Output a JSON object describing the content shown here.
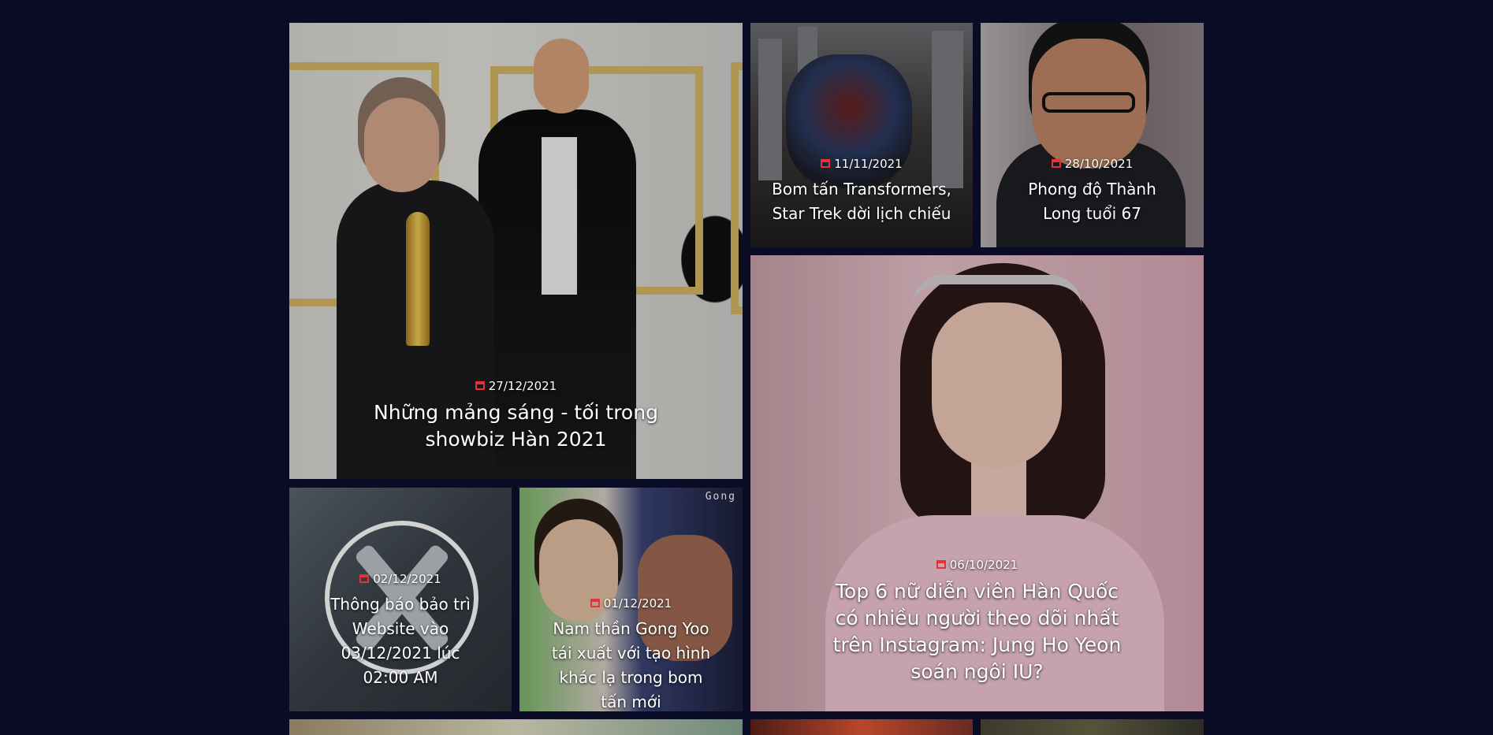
{
  "articles": [
    {
      "date": "27/12/2021",
      "title": "Những mảng sáng - tối trong showbiz Hàn 2021"
    },
    {
      "date": "11/11/2021",
      "title": "Bom tấn Transformers, Star Trek dời lịch chiếu"
    },
    {
      "date": "28/10/2021",
      "title": "Phong độ Thành Long tuổi 67"
    },
    {
      "date": "06/10/2021",
      "title": "Top 6 nữ diễn viên Hàn Quốc có nhiều người theo dõi nhất trên Instagram: Jung Ho Yeon soán ngôi IU?"
    },
    {
      "date": "02/12/2021",
      "title": "Thông báo bảo trì Website vào 03/12/2021 lúc 02:00 AM"
    },
    {
      "date": "01/12/2021",
      "title": "Nam thần Gong Yoo tái xuất với tạo hình khác lạ trong bom tấn mới"
    }
  ],
  "image_text": {
    "gong_tag": "Gong"
  },
  "colors": {
    "background": "#0a0c26",
    "calendar_icon": "#e5313a"
  }
}
